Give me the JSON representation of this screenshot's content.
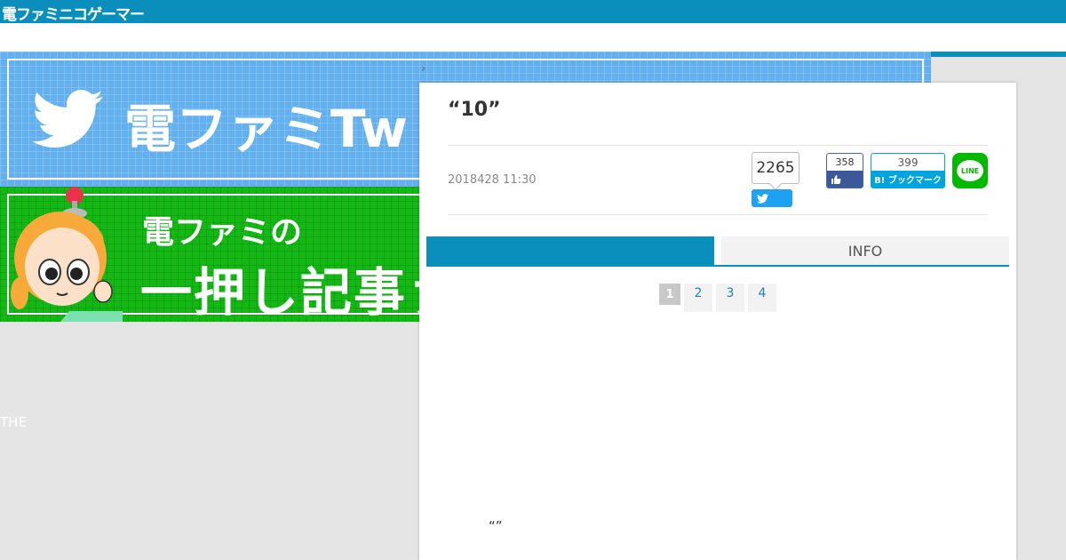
{
  "header": {
    "logo": "電ファミニコゲーマー"
  },
  "banners": {
    "twitter_text": "電ファミTw",
    "pickup_line1": "電ファミの",
    "pickup_line2": "一押し記事ァ"
  },
  "sidebar": {
    "text": "THE"
  },
  "breadcrumb": {
    "chevron": "›"
  },
  "article": {
    "title": "“10”",
    "date": "2018428 11:30",
    "quote": "“”"
  },
  "share": {
    "twitter_count": "2265",
    "facebook_count": "358",
    "hatena_count": "399",
    "hatena_label": "B! ブックマーク",
    "line_label": "LINE"
  },
  "tabs": {
    "first": "",
    "second": "INFO"
  },
  "pager": {
    "pages": [
      "1",
      "2",
      "3",
      "4"
    ]
  },
  "colors": {
    "brand": "#0a8fbc",
    "twitter": "#1da1f2",
    "facebook": "#3b5998",
    "hatena": "#00a4de",
    "line": "#00b900"
  }
}
